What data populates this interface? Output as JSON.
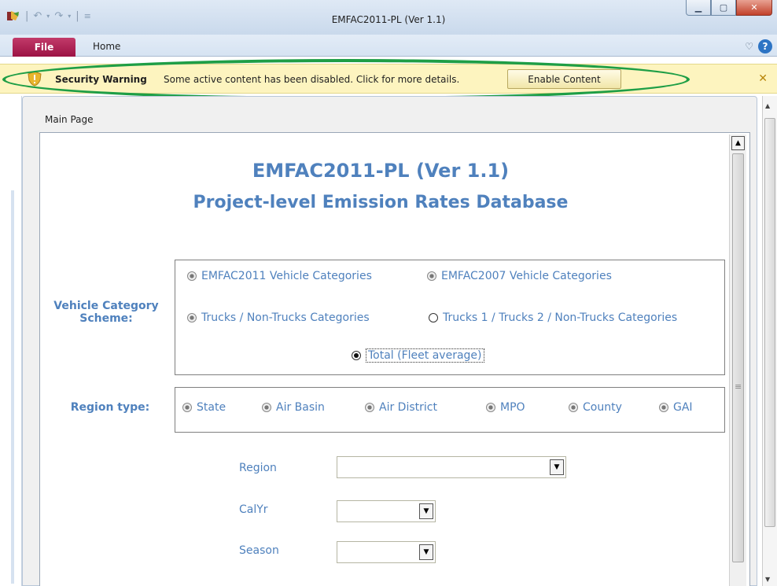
{
  "window": {
    "title": "EMFAC2011-PL (Ver 1.1)",
    "qat_icons": [
      "undo-icon",
      "redo-icon",
      "customize-icon"
    ],
    "controls": [
      "minimize",
      "maximize",
      "close"
    ]
  },
  "ribbon": {
    "file_label": "File",
    "home_label": "Home"
  },
  "message_bar": {
    "title": "Security Warning",
    "message": "Some active content has been disabled. Click for more details.",
    "button_label": "Enable Content",
    "highlight_color": "#1e9e46"
  },
  "document": {
    "tab_label": "Main Page"
  },
  "form": {
    "title_line1": "EMFAC2011-PL (Ver 1.1)",
    "title_line2": "Project-level Emission Rates Database",
    "vehicle_category": {
      "label_line1": "Vehicle Category",
      "label_line2": "Scheme:",
      "options": [
        {
          "label": "EMFAC2011 Vehicle Categories",
          "selected": false
        },
        {
          "label": "EMFAC2007 Vehicle Categories",
          "selected": false
        },
        {
          "label": "Trucks / Non-Trucks Categories",
          "selected": false
        },
        {
          "label": "Trucks 1 / Trucks 2 / Non-Trucks Categories",
          "selected": false
        },
        {
          "label": "Total (Fleet average)",
          "selected": true
        }
      ]
    },
    "region_type": {
      "label": "Region type:",
      "options": [
        "State",
        "Air Basin",
        "Air District",
        "MPO",
        "County",
        "GAI"
      ]
    },
    "fields": {
      "region_label": "Region",
      "region_value": "",
      "calyr_label": "CalYr",
      "calyr_value": "",
      "season_label": "Season",
      "season_value": ""
    }
  },
  "colors": {
    "accent_blue": "#4f81bd",
    "warning_bg": "#fdf4bf",
    "file_tab": "#b0245a"
  }
}
